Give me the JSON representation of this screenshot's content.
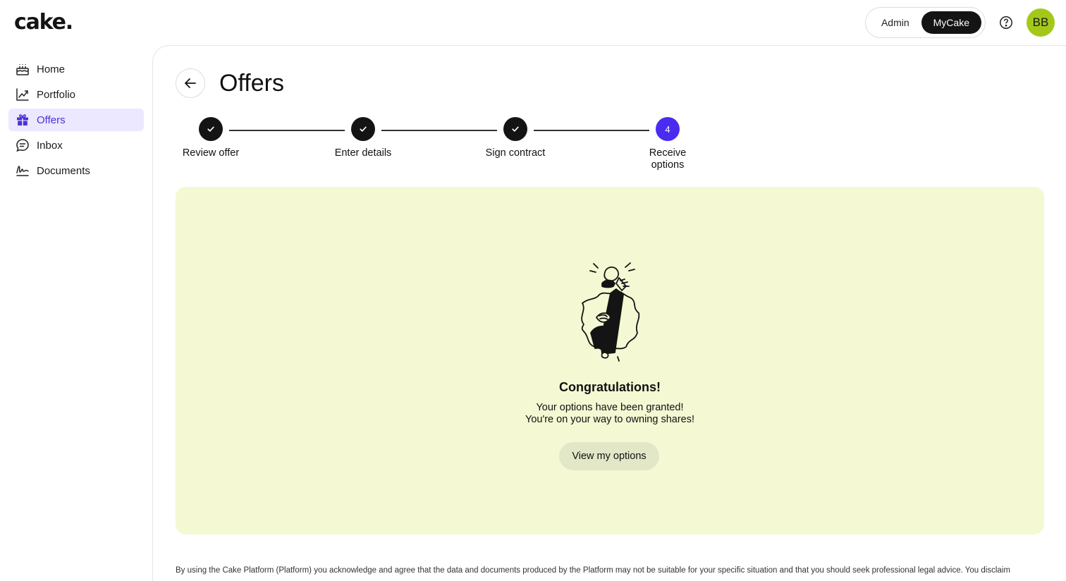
{
  "brand": {
    "logo_text": "cake."
  },
  "topbar": {
    "modes": [
      "Admin",
      "MyCake"
    ],
    "active_mode": "MyCake",
    "help_icon": "question-circle-icon",
    "avatar_initials": "BB",
    "avatar_color": "#a4c81a"
  },
  "sidebar": {
    "items": [
      {
        "label": "Home",
        "icon": "cake-icon",
        "active": false
      },
      {
        "label": "Portfolio",
        "icon": "chart-line-icon",
        "active": false
      },
      {
        "label": "Offers",
        "icon": "gift-icon",
        "active": true
      },
      {
        "label": "Inbox",
        "icon": "chat-bubble-icon",
        "active": false
      },
      {
        "label": "Documents",
        "icon": "signature-icon",
        "active": false
      }
    ],
    "active_color": "#4a32d4",
    "active_bg": "#ebe8ff"
  },
  "page": {
    "title": "Offers",
    "back_icon": "arrow-left-icon"
  },
  "stepper": {
    "steps": [
      {
        "label": "Review offer",
        "status": "done",
        "icon": "check-icon"
      },
      {
        "label": "Enter details",
        "status": "done",
        "icon": "check-icon"
      },
      {
        "label": "Sign contract",
        "status": "done",
        "icon": "check-icon"
      },
      {
        "label": "Receive options",
        "status": "current",
        "number": "4"
      }
    ],
    "current_color": "#4a2cf0"
  },
  "success_card": {
    "background": "#f4f9d3",
    "illustration": "person-raising-cup-illustration",
    "title": "Congratulations!",
    "line1": "Your options have been granted!",
    "line2": "You're on your way to owning shares!",
    "button_label": "View my options"
  },
  "footer": {
    "disclaimer": "By using the Cake Platform (Platform) you acknowledge and agree that the data and documents produced by the Platform may not be suitable for your specific situation and that you should seek professional legal advice. You disclaim"
  }
}
